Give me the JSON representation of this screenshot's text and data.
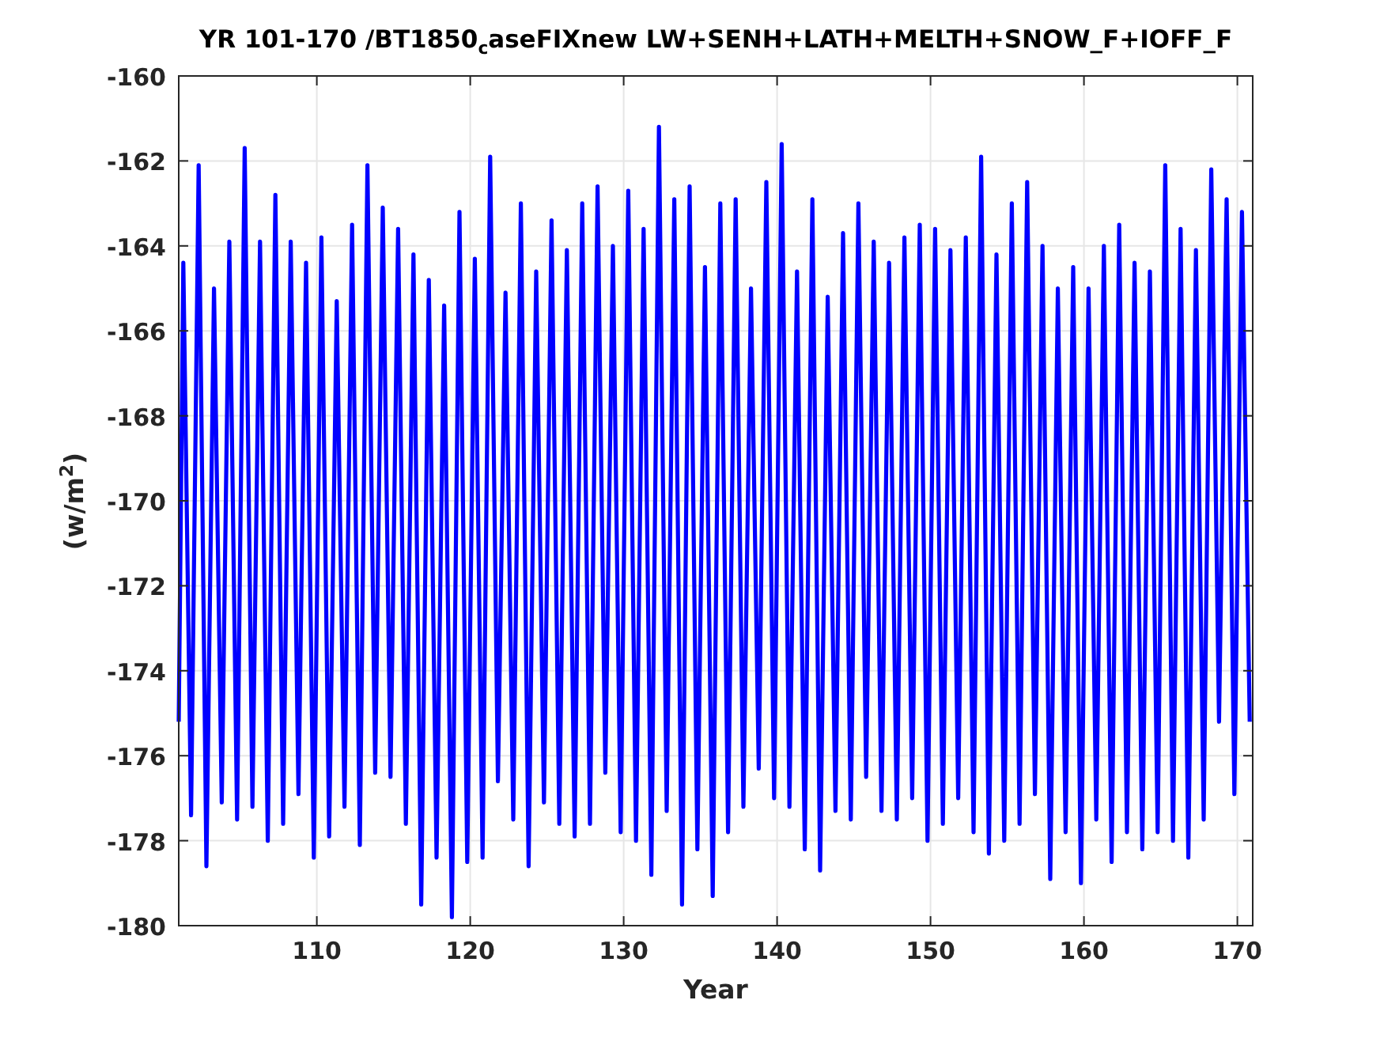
{
  "figure": {
    "title": "YR 101-170 /BT1850$_{c}$aseFIXnew LW+SENH+LATH+MELTH+SNOW_F+IOFF_F",
    "chart_data": {
      "type": "line",
      "xlabel": "Year",
      "ylabel": "(w/m$^{2}$)",
      "xlim": [
        101,
        171
      ],
      "ylim": [
        -180,
        -160
      ],
      "grid": true,
      "xticks": [
        110,
        120,
        130,
        140,
        150,
        160,
        170
      ],
      "yticks": [
        -180,
        -178,
        -176,
        -174,
        -172,
        -170,
        -168,
        -166,
        -164,
        -162,
        -160
      ],
      "x": [
        101,
        101.3,
        101.8,
        102.3,
        102.8,
        103.3,
        103.8,
        104.3,
        104.8,
        105.3,
        105.8,
        106.3,
        106.8,
        107.3,
        107.8,
        108.3,
        108.8,
        109.3,
        109.8,
        110.3,
        110.8,
        111.3,
        111.8,
        112.3,
        112.8,
        113.3,
        113.8,
        114.3,
        114.8,
        115.3,
        115.8,
        116.3,
        116.8,
        117.3,
        117.8,
        118.3,
        118.8,
        119.3,
        119.8,
        120.3,
        120.8,
        121.3,
        121.8,
        122.3,
        122.8,
        123.3,
        123.8,
        124.3,
        124.8,
        125.3,
        125.8,
        126.3,
        126.8,
        127.3,
        127.8,
        128.3,
        128.8,
        129.3,
        129.8,
        130.3,
        130.8,
        131.3,
        131.8,
        132.3,
        132.8,
        133.3,
        133.8,
        134.3,
        134.8,
        135.3,
        135.8,
        136.3,
        136.8,
        137.3,
        137.8,
        138.3,
        138.8,
        139.3,
        139.8,
        140.3,
        140.8,
        141.3,
        141.8,
        142.3,
        142.8,
        143.3,
        143.8,
        144.3,
        144.8,
        145.3,
        145.8,
        146.3,
        146.8,
        147.3,
        147.8,
        148.3,
        148.8,
        149.3,
        149.8,
        150.3,
        150.8,
        151.3,
        151.8,
        152.3,
        152.8,
        153.3,
        153.8,
        154.3,
        154.8,
        155.3,
        155.8,
        156.3,
        156.8,
        157.3,
        157.8,
        158.3,
        158.8,
        159.3,
        159.8,
        160.3,
        160.8,
        161.3,
        161.8,
        162.3,
        162.8,
        163.3,
        163.8,
        164.3,
        164.8,
        165.3,
        165.8,
        166.3,
        166.8,
        167.3,
        167.8,
        168.3,
        168.8,
        169.3,
        169.8,
        170.3,
        170.8
      ],
      "series": [
        {
          "color": "#0000ff",
          "values": [
            -175.2,
            -164.4,
            -177.4,
            -162.1,
            -178.6,
            -165.0,
            -177.1,
            -163.9,
            -177.5,
            -161.7,
            -177.2,
            -163.9,
            -178.0,
            -162.8,
            -177.6,
            -163.9,
            -176.9,
            -164.4,
            -178.4,
            -163.8,
            -177.9,
            -165.3,
            -177.2,
            -163.5,
            -178.1,
            -162.1,
            -176.4,
            -163.1,
            -176.5,
            -163.6,
            -177.6,
            -164.2,
            -179.5,
            -164.8,
            -178.4,
            -165.4,
            -179.8,
            -163.2,
            -178.5,
            -164.3,
            -178.4,
            -161.9,
            -176.6,
            -165.1,
            -177.5,
            -163.0,
            -178.6,
            -164.6,
            -177.1,
            -163.4,
            -177.6,
            -164.1,
            -177.9,
            -163.0,
            -177.6,
            -162.6,
            -176.4,
            -164.0,
            -177.8,
            -162.7,
            -178.0,
            -163.6,
            -178.8,
            -161.2,
            -177.3,
            -162.9,
            -179.5,
            -162.6,
            -178.2,
            -164.5,
            -179.3,
            -163.0,
            -177.8,
            -162.9,
            -177.2,
            -165.0,
            -176.3,
            -162.5,
            -177.0,
            -161.6,
            -177.2,
            -164.6,
            -178.2,
            -162.9,
            -178.7,
            -165.2,
            -177.3,
            -163.7,
            -177.5,
            -163.0,
            -176.5,
            -163.9,
            -177.3,
            -164.4,
            -177.5,
            -163.8,
            -177.0,
            -163.5,
            -178.0,
            -163.6,
            -177.6,
            -164.1,
            -177.0,
            -163.8,
            -177.8,
            -161.9,
            -178.3,
            -164.2,
            -178.0,
            -163.0,
            -177.6,
            -162.5,
            -176.9,
            -164.0,
            -178.9,
            -165.0,
            -177.8,
            -164.5,
            -179.0,
            -165.0,
            -177.5,
            -164.0,
            -178.5,
            -163.5,
            -177.8,
            -164.4,
            -178.2,
            -164.6,
            -177.8,
            -162.1,
            -178.0,
            -163.6,
            -178.4,
            -164.1,
            -177.5,
            -162.2,
            -175.2,
            -162.9,
            -176.9,
            -163.2,
            -175.2
          ]
        }
      ]
    }
  }
}
